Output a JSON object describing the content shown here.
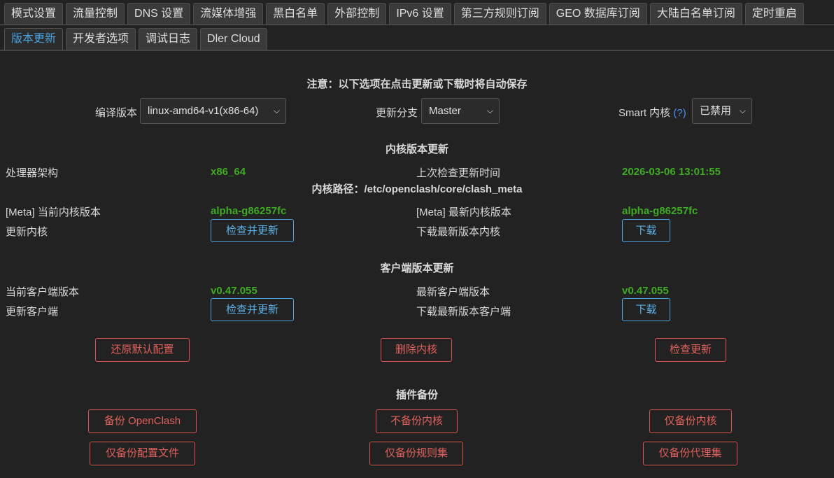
{
  "tabs_row1": [
    "模式设置",
    "流量控制",
    "DNS 设置",
    "流媒体增强",
    "黑白名单",
    "外部控制",
    "IPv6 设置",
    "第三方规则订阅",
    "GEO 数据库订阅",
    "大陆白名单订阅",
    "定时重启"
  ],
  "tabs_row2": [
    "版本更新",
    "开发者选项",
    "调试日志",
    "Dler Cloud"
  ],
  "active_tab_row2": "版本更新",
  "notice": "注意：以下选项在点击更新或下载时将自动保存",
  "options": {
    "compile_label": "编译版本",
    "compile_value": "linux-amd64-v1(x86-64)",
    "branch_label": "更新分支",
    "branch_value": "Master",
    "smart_label": "Smart 内核",
    "smart_help": "(?)",
    "smart_value": "已禁用"
  },
  "core_section": {
    "title": "内核版本更新",
    "arch_label": "处理器架构",
    "arch_value": "x86_64",
    "last_check_label": "上次检查更新时间",
    "last_check_value": "2026-03-06 13:01:55",
    "core_path": "内核路径：/etc/openclash/core/clash_meta",
    "current_label": "[Meta] 当前内核版本",
    "current_value": "alpha-g86257fc",
    "latest_label": "[Meta] 最新内核版本",
    "latest_value": "alpha-g86257fc",
    "update_label": "更新内核",
    "update_button": "检查并更新",
    "download_label": "下载最新版本内核",
    "download_button": "下载"
  },
  "client_section": {
    "title": "客户端版本更新",
    "current_label": "当前客户端版本",
    "current_value": "v0.47.055",
    "latest_label": "最新客户端版本",
    "latest_value": "v0.47.055",
    "update_label": "更新客户端",
    "update_button": "检查并更新",
    "download_label": "下载最新版本客户端",
    "download_button": "下载"
  },
  "actions": {
    "restore": "还原默认配置",
    "delete_core": "删除内核",
    "check_update": "检查更新"
  },
  "backup_section": {
    "title": "插件备份",
    "backup_openclash": "备份 OpenClash",
    "no_backup_core": "不备份内核",
    "backup_core_only": "仅备份内核",
    "backup_config_only": "仅备份配置文件",
    "backup_rules_only": "仅备份规则集",
    "backup_proxy_only": "仅备份代理集"
  },
  "colors": {
    "background": "#222222",
    "accent_blue": "#4aa3df",
    "value_green": "#3faa24",
    "danger_red": "#d9534f"
  }
}
